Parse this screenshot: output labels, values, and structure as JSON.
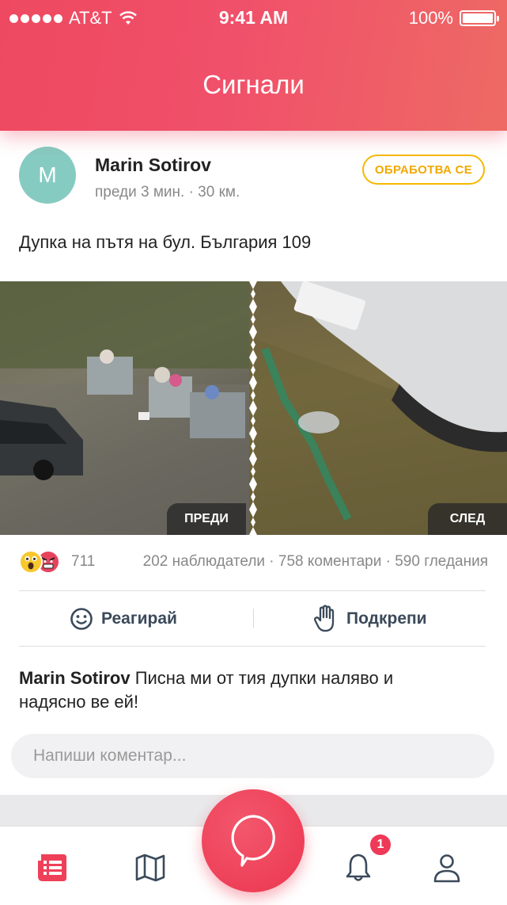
{
  "status_bar": {
    "carrier": "AT&T",
    "time": "9:41 AM",
    "battery": "100%",
    "battery_level": 1.0
  },
  "header": {
    "title": "Сигнали"
  },
  "post": {
    "avatar_initial": "M",
    "author": "Marin Sotirov",
    "time_ago": "преди 3 мин.",
    "distance": "30 км.",
    "status_badge": "ОБРАБОТВА СЕ",
    "text": "Дупка на пътя на бул. България 109",
    "photo_before_label": "ПРЕДИ",
    "photo_after_label": "СЛЕД",
    "reaction_count": "711",
    "stats": "202 наблюдатели · 758 коментари · 590 гледания",
    "react_label": "Реагирай",
    "support_label": "Подкрепи",
    "comment_author": "Marin Sotirov",
    "comment_text": "Писна ми от тия дупки наляво и надясно ве ей!",
    "comment_placeholder": "Напиши коментар..."
  },
  "nav": {
    "items": [
      "feed-icon",
      "map-icon",
      "report-icon",
      "bell-icon",
      "profile-icon"
    ],
    "notification_count": "1",
    "accent": "#ee4058"
  }
}
